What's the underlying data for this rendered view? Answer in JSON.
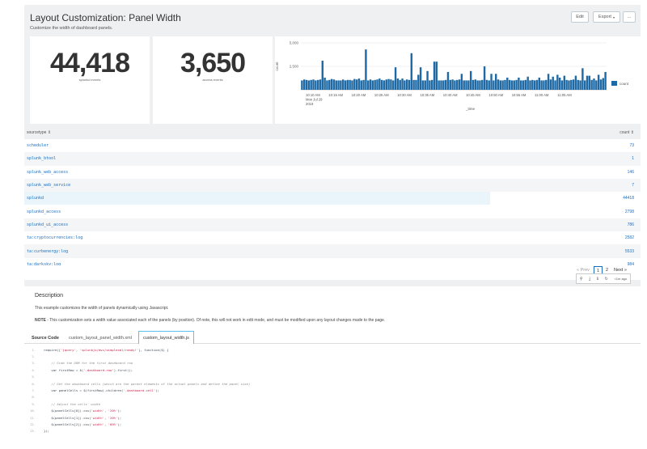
{
  "header": {
    "title": "Layout Customization: Panel Width",
    "subtitle": "Customize the width of dashboard panels.",
    "edit_label": "Edit",
    "export_label": "Export",
    "more_label": "..."
  },
  "single_values": [
    {
      "value": "44,418",
      "label": "splunkd events"
    },
    {
      "value": "3,650",
      "label": "access events"
    }
  ],
  "chart_data": {
    "type": "bar",
    "ylabel": "count",
    "xlabel": "_time",
    "ylim": [
      0,
      5000
    ],
    "yticks": [
      "5,000",
      "2,500"
    ],
    "legend": "count",
    "legend_position": "right",
    "xtick_labels": [
      "10:10 AM\nMon Jul 29\n2019",
      "10:15 AM",
      "10:20 AM",
      "10:25 AM",
      "10:30 AM",
      "10:35 AM",
      "10:40 AM",
      "10:45 AM",
      "10:50 AM",
      "10:55 AM",
      "11:00 AM",
      "11:05 AM"
    ],
    "values": [
      1000,
      1100,
      1050,
      1000,
      1050,
      1100,
      1000,
      1050,
      1100,
      3100,
      1300,
      1000,
      1050,
      1150,
      1100,
      1000,
      1000,
      1000,
      1100,
      1000,
      1050,
      1050,
      1000,
      1150,
      1100,
      1200,
      1000,
      1050,
      4300,
      1000,
      1100,
      1000,
      1050,
      1100,
      1200,
      1050,
      1000,
      1100,
      1150,
      1100,
      1000,
      2400,
      1200,
      1050,
      1200,
      1000,
      1100,
      1050,
      3900,
      1050,
      1050,
      1600,
      2400,
      1000,
      1000,
      2000,
      1000,
      1050,
      3000,
      3000,
      1000,
      1000,
      1000,
      1050,
      1900,
      1050,
      1100,
      1000,
      1050,
      1100,
      1700,
      1000,
      1000,
      1000,
      2000,
      1050,
      1100,
      1000,
      1000,
      1050,
      2500,
      1050,
      1000,
      1700,
      1000,
      1700,
      1100,
      1000,
      1000,
      1050,
      1300,
      1050,
      1000,
      1000,
      1050,
      1300,
      1000,
      1000,
      1050,
      1400,
      1000,
      1050,
      1000,
      1050,
      1300,
      1000,
      1000,
      1050,
      1700,
      1100,
      1400,
      1000,
      1600,
      1300,
      1000,
      1500,
      1050,
      1000,
      1050,
      1100,
      1500,
      1050,
      1000,
      2300,
      1000,
      1500,
      1500,
      1050,
      1200,
      1000,
      1600,
      1100,
      1250,
      1900
    ]
  },
  "table": {
    "headers": [
      "sourcetype ⇕",
      "count ⇕"
    ],
    "rows": [
      [
        "scheduler",
        "73"
      ],
      [
        "splunk_btool",
        "1"
      ],
      [
        "splunk_web_access",
        "146"
      ],
      [
        "splunk_web_service",
        "7"
      ],
      [
        "splunkd",
        "44418"
      ],
      [
        "splunkd_access",
        "2798"
      ],
      [
        "splunkd_ui_access",
        "786"
      ],
      [
        "ta:cryptocurrencies:log",
        "2582"
      ],
      [
        "ta:curbenergy:log",
        "5533"
      ],
      [
        "ta:darksky:log",
        "984"
      ]
    ]
  },
  "pagination": {
    "prev": "« Prev",
    "page1": "1",
    "page2": "2",
    "next": "Next »"
  },
  "table_tools": {
    "search": "⚲",
    "export": "⤓",
    "info": "ℹ",
    "refresh": "↻",
    "ago": "<1m ago"
  },
  "description": {
    "heading": "Description",
    "text1": "This example customizes the width of panels dynamically using Javascript.",
    "note_label": "NOTE",
    "note_text": " - This customization sets a width value associated each of the panels (by position). Of note, this will not work in edit mode, and must be modified upon any layout changes made to the page."
  },
  "tabs": [
    {
      "label": "Source Code"
    },
    {
      "label": "custom_layout_panel_width.xml"
    },
    {
      "label": "custom_layout_width.js"
    }
  ],
  "code": [
    {
      "n": "1.",
      "t": "require(['jquery', 'splunkjs/mvc/simplexml/ready!'], function($) {",
      "k": "code"
    },
    {
      "n": "2.",
      "t": "",
      "k": "code"
    },
    {
      "n": "3.",
      "t": "    // Grab the DOM for the first dashboard row",
      "k": "cmt"
    },
    {
      "n": "4.",
      "t": "    var firstRow = $('.dashboard-row').first();",
      "k": "code"
    },
    {
      "n": "5.",
      "t": "",
      "k": "code"
    },
    {
      "n": "6.",
      "t": "    // Get the dashboard cells (which are the parent elements of the actual panels and define the panel size)",
      "k": "cmt"
    },
    {
      "n": "7.",
      "t": "    var panelCells = $(firstRow).children('.dashboard-cell');",
      "k": "code"
    },
    {
      "n": "8.",
      "t": "",
      "k": "code"
    },
    {
      "n": "9.",
      "t": "    // Adjust the cells' width",
      "k": "cmt"
    },
    {
      "n": "10.",
      "t": "    $(panelCells[0]).css('width', '20%');",
      "k": "code"
    },
    {
      "n": "11.",
      "t": "    $(panelCells[1]).css('width', '20%');",
      "k": "code"
    },
    {
      "n": "12.",
      "t": "    $(panelCells[2]).css('width', '60%');",
      "k": "code"
    },
    {
      "n": "13.",
      "t": "});",
      "k": "code"
    }
  ],
  "colors": {
    "bar": "#1f6aa5",
    "link": "#1a6ec0",
    "accent_tab": "#5cc0f0"
  }
}
